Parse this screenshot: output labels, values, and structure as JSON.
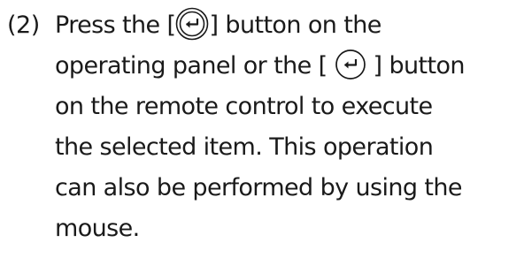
{
  "step": {
    "number": "(2)",
    "line1_a": "Press the",
    "line1_b": "button on the",
    "line2_a": "operating panel or the",
    "line2_b": "button",
    "line3": "on the remote control to execute",
    "line4": "the selected item. This operation",
    "line5": "can also be performed by using the",
    "line6": "mouse.",
    "bracket_open": "[",
    "bracket_close": "]"
  },
  "icons": {
    "panel_enter": "enter-key-icon",
    "remote_enter": "enter-key-icon"
  }
}
